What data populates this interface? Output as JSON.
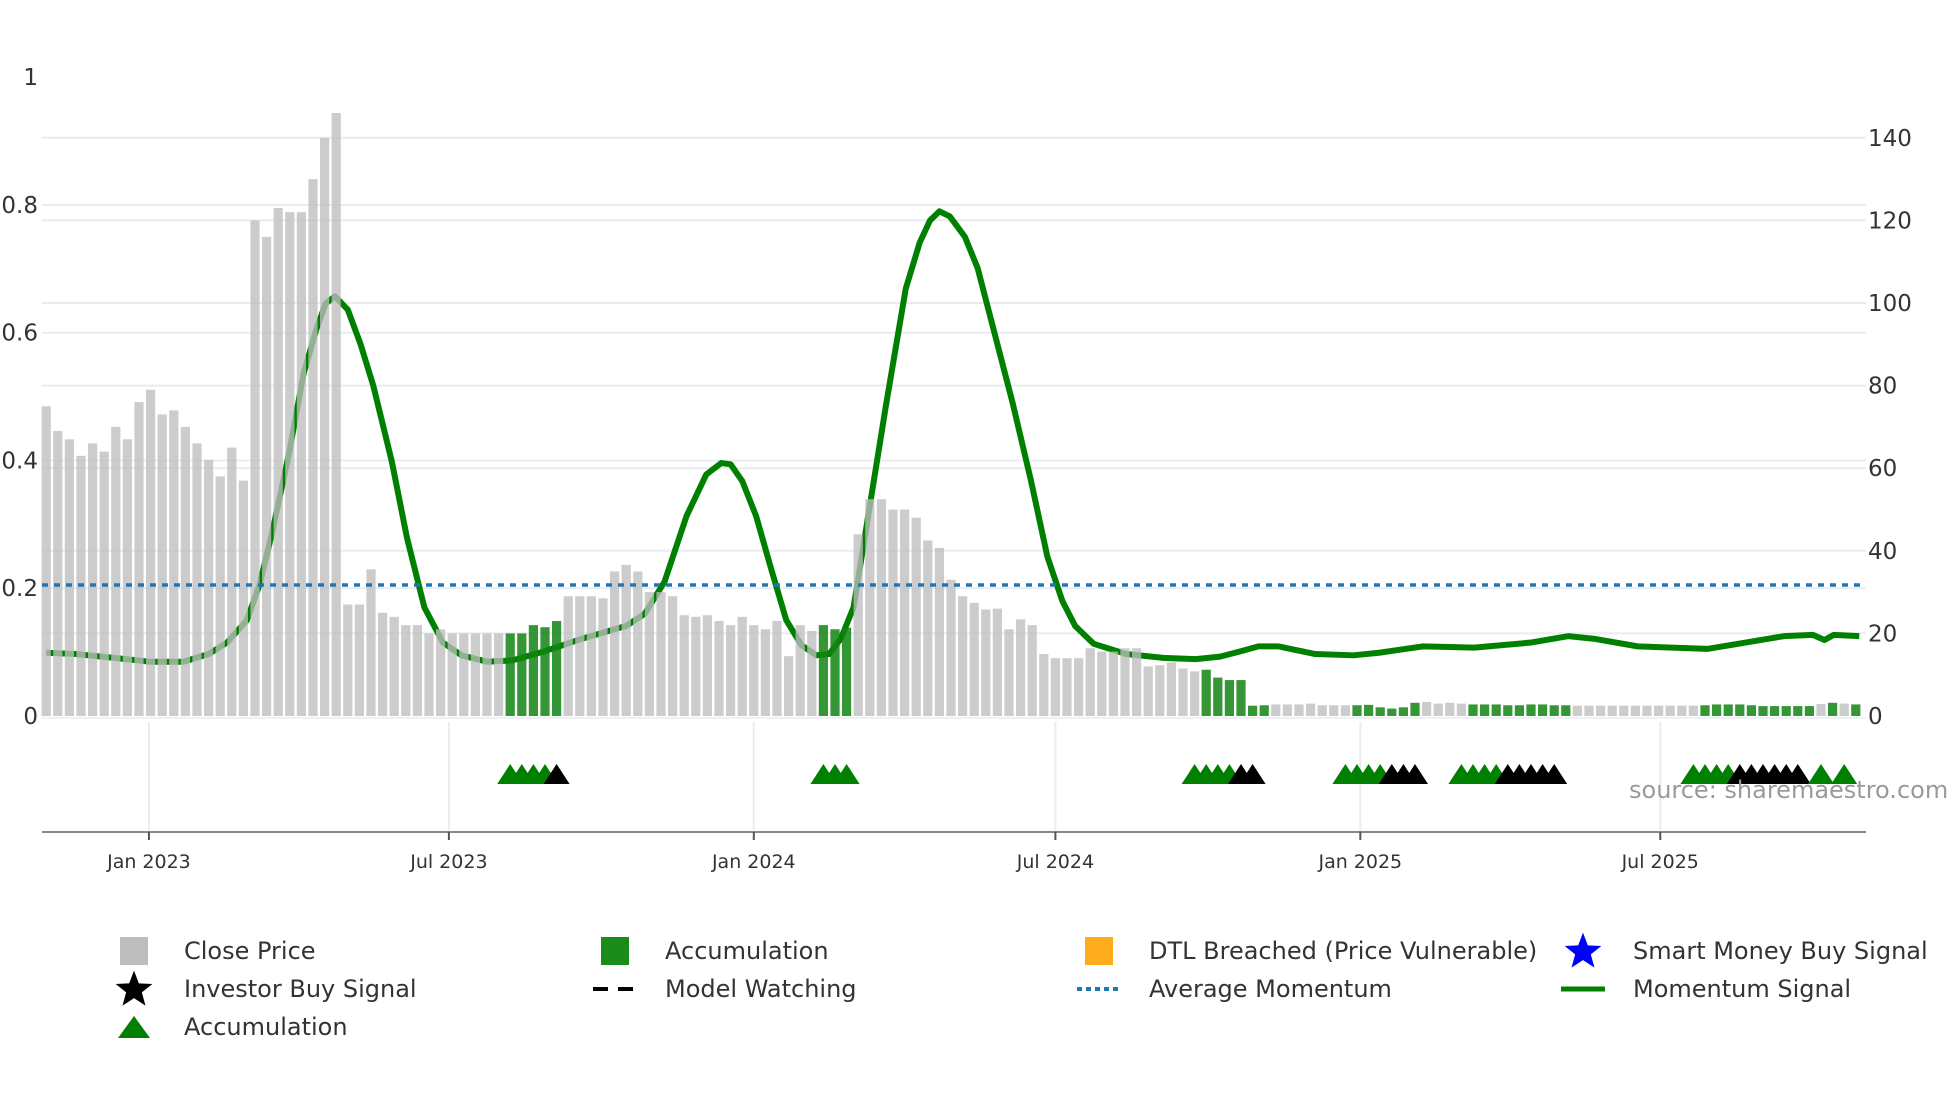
{
  "chart_data": {
    "type": "bar+line",
    "title": "",
    "start_week": "2022-10-31",
    "left_axis": {
      "label": "",
      "ylim": [
        0,
        1
      ],
      "ticks": [
        "0",
        "0.2",
        "0.4",
        "0.6",
        "0.8",
        "1"
      ],
      "tick_values": [
        0,
        0.2,
        0.4,
        0.6,
        0.8,
        1
      ]
    },
    "right_axis": {
      "label": "",
      "ylim": [
        0,
        150
      ],
      "ticks": [
        "0",
        "20",
        "40",
        "60",
        "80",
        "100",
        "120",
        "140"
      ],
      "tick_values": [
        0,
        20,
        40,
        60,
        80,
        100,
        120,
        140
      ]
    },
    "x_ticks": [
      {
        "label": "Jan 2023",
        "date": "2023-01-01"
      },
      {
        "label": "Jul 2023",
        "date": "2023-07-01"
      },
      {
        "label": "Jan 2024",
        "date": "2024-01-01"
      },
      {
        "label": "Jul 2024",
        "date": "2024-07-01"
      },
      {
        "label": "Jan 2025",
        "date": "2025-01-01"
      },
      {
        "label": "Jul 2025",
        "date": "2025-07-01"
      }
    ],
    "close_price": [
      75,
      69,
      67,
      63,
      66,
      64,
      70,
      67,
      76,
      79,
      73,
      74,
      70,
      66,
      62,
      58,
      65,
      57,
      120,
      116,
      123,
      122,
      122,
      130,
      140,
      146,
      27,
      27,
      35.5,
      25,
      24,
      22,
      22,
      20,
      21,
      20,
      20,
      20,
      20,
      20,
      20,
      20,
      22,
      21.5,
      23,
      29,
      29,
      29,
      28.5,
      35,
      36.6,
      35,
      30,
      30,
      29,
      24.4,
      24,
      24.4,
      23,
      22,
      24,
      22,
      21,
      23,
      14.5,
      22,
      20.6,
      22,
      21,
      21.4,
      44,
      52.5,
      52.5,
      50,
      50,
      48,
      42.5,
      40.7,
      33,
      29,
      27.4,
      25.8,
      26,
      21,
      23.4,
      22,
      15,
      14,
      14,
      14,
      16.4,
      15.6,
      15.6,
      16.4,
      16.4,
      12,
      12.3,
      13,
      11.5,
      10.8,
      11.2,
      9.3,
      8.7,
      8.7,
      2.5,
      2.6,
      2.8,
      2.8,
      2.8,
      3,
      2.6,
      2.6,
      2.6,
      2.6,
      2.7,
      2.1,
      1.8,
      2.1,
      3.2,
      3.4,
      3,
      3.2,
      3,
      2.8,
      2.8,
      2.8,
      2.6,
      2.6,
      2.8,
      2.8,
      2.6,
      2.6,
      2.5,
      2.5,
      2.5,
      2.5,
      2.5,
      2.5,
      2.5,
      2.5,
      2.5,
      2.5,
      2.5,
      2.6,
      2.8,
      2.8,
      2.8,
      2.6,
      2.4,
      2.4,
      2.4,
      2.4,
      2.4,
      2.9,
      3.2,
      3,
      2.8
    ],
    "accumulation_weeks": [
      40,
      41,
      42,
      43,
      44,
      67,
      68,
      69,
      100,
      101,
      102,
      103,
      104,
      105,
      113,
      114,
      115,
      116,
      117,
      118,
      123,
      124,
      125,
      126,
      127,
      128,
      129,
      130,
      131,
      143,
      144,
      145,
      146,
      147,
      148,
      149,
      150,
      151,
      152,
      154,
      156
    ],
    "momentum_signal": [
      [
        0,
        0.099
      ],
      [
        2.56,
        0.097
      ],
      [
        5.83,
        0.091
      ],
      [
        8.89,
        0.085
      ],
      [
        11.83,
        0.085
      ],
      [
        14,
        0.097
      ],
      [
        15.6,
        0.115
      ],
      [
        17.3,
        0.15
      ],
      [
        18.4,
        0.206
      ],
      [
        19.5,
        0.289
      ],
      [
        20.9,
        0.408
      ],
      [
        22.2,
        0.537
      ],
      [
        23.3,
        0.606
      ],
      [
        24.1,
        0.646
      ],
      [
        24.9,
        0.657
      ],
      [
        26,
        0.636
      ],
      [
        27.1,
        0.582
      ],
      [
        28.2,
        0.517
      ],
      [
        29.8,
        0.398
      ],
      [
        31.1,
        0.279
      ],
      [
        32.6,
        0.17
      ],
      [
        34.2,
        0.115
      ],
      [
        35.8,
        0.095
      ],
      [
        38,
        0.085
      ],
      [
        40.2,
        0.087
      ],
      [
        42.9,
        0.101
      ],
      [
        46.2,
        0.121
      ],
      [
        50,
        0.141
      ],
      [
        51.6,
        0.16
      ],
      [
        53.3,
        0.21
      ],
      [
        55.2,
        0.313
      ],
      [
        56.9,
        0.378
      ],
      [
        58.2,
        0.396
      ],
      [
        59,
        0.394
      ],
      [
        60,
        0.368
      ],
      [
        61.2,
        0.313
      ],
      [
        62.5,
        0.23
      ],
      [
        63.8,
        0.15
      ],
      [
        65.1,
        0.111
      ],
      [
        66.4,
        0.095
      ],
      [
        67.5,
        0.097
      ],
      [
        68.5,
        0.121
      ],
      [
        69.6,
        0.17
      ],
      [
        71,
        0.329
      ],
      [
        72.4,
        0.487
      ],
      [
        74.1,
        0.669
      ],
      [
        75.3,
        0.741
      ],
      [
        76.2,
        0.776
      ],
      [
        77,
        0.79
      ],
      [
        77.9,
        0.782
      ],
      [
        79.2,
        0.75
      ],
      [
        80.3,
        0.701
      ],
      [
        81.8,
        0.596
      ],
      [
        83.3,
        0.491
      ],
      [
        84.9,
        0.368
      ],
      [
        86.3,
        0.25
      ],
      [
        87.6,
        0.18
      ],
      [
        88.7,
        0.141
      ],
      [
        90.3,
        0.113
      ],
      [
        93.1,
        0.097
      ],
      [
        96.3,
        0.091
      ],
      [
        99.1,
        0.089
      ],
      [
        101.2,
        0.093
      ],
      [
        102.9,
        0.101
      ],
      [
        104.5,
        0.109
      ],
      [
        106.2,
        0.109
      ],
      [
        109.4,
        0.097
      ],
      [
        112.7,
        0.095
      ],
      [
        114.9,
        0.099
      ],
      [
        118.7,
        0.109
      ],
      [
        123.1,
        0.107
      ],
      [
        128,
        0.115
      ],
      [
        131.2,
        0.125
      ],
      [
        133.4,
        0.121
      ],
      [
        137.2,
        0.109
      ],
      [
        143.2,
        0.105
      ],
      [
        146.5,
        0.115
      ],
      [
        149.8,
        0.125
      ],
      [
        152.3,
        0.127
      ],
      [
        153.3,
        0.119
      ],
      [
        154.1,
        0.127
      ],
      [
        156.3,
        0.125
      ]
    ],
    "average_momentum": 0.205,
    "signal_markers": [
      {
        "week": 40,
        "type": "accumulation"
      },
      {
        "week": 41,
        "type": "accumulation"
      },
      {
        "week": 42,
        "type": "accumulation"
      },
      {
        "week": 43,
        "type": "accumulation"
      },
      {
        "week": 44,
        "type": "investor_buy"
      },
      {
        "week": 67,
        "type": "accumulation"
      },
      {
        "week": 68,
        "type": "accumulation"
      },
      {
        "week": 69,
        "type": "accumulation"
      },
      {
        "week": 99,
        "type": "accumulation"
      },
      {
        "week": 100,
        "type": "accumulation"
      },
      {
        "week": 101,
        "type": "accumulation"
      },
      {
        "week": 102,
        "type": "accumulation"
      },
      {
        "week": 103,
        "type": "investor_buy"
      },
      {
        "week": 104,
        "type": "investor_buy"
      },
      {
        "week": 112,
        "type": "accumulation"
      },
      {
        "week": 113,
        "type": "accumulation"
      },
      {
        "week": 114,
        "type": "accumulation"
      },
      {
        "week": 115,
        "type": "accumulation"
      },
      {
        "week": 116,
        "type": "investor_buy"
      },
      {
        "week": 117,
        "type": "investor_buy"
      },
      {
        "week": 118,
        "type": "investor_buy"
      },
      {
        "week": 122,
        "type": "accumulation"
      },
      {
        "week": 123,
        "type": "accumulation"
      },
      {
        "week": 124,
        "type": "accumulation"
      },
      {
        "week": 125,
        "type": "accumulation"
      },
      {
        "week": 126,
        "type": "investor_buy"
      },
      {
        "week": 127,
        "type": "investor_buy"
      },
      {
        "week": 128,
        "type": "investor_buy"
      },
      {
        "week": 129,
        "type": "investor_buy"
      },
      {
        "week": 130,
        "type": "investor_buy"
      },
      {
        "week": 142,
        "type": "accumulation"
      },
      {
        "week": 143,
        "type": "accumulation"
      },
      {
        "week": 144,
        "type": "accumulation"
      },
      {
        "week": 145,
        "type": "accumulation"
      },
      {
        "week": 146,
        "type": "investor_buy"
      },
      {
        "week": 147,
        "type": "investor_buy"
      },
      {
        "week": 148,
        "type": "investor_buy"
      },
      {
        "week": 149,
        "type": "investor_buy"
      },
      {
        "week": 150,
        "type": "investor_buy"
      },
      {
        "week": 151,
        "type": "investor_buy"
      },
      {
        "week": 153,
        "type": "accumulation"
      },
      {
        "week": 155,
        "type": "accumulation"
      }
    ],
    "colors": {
      "close": "#bdbdbd",
      "accumulation": "#1a8c1a",
      "momentum": "#008000",
      "average": "#1f77b4",
      "investor": "#000000",
      "smart_money": "#0000ff",
      "dtl": "#ffa500"
    },
    "legend": [
      {
        "label": "Close Price",
        "symbol": "gray-square"
      },
      {
        "label": "Accumulation",
        "symbol": "green-square"
      },
      {
        "label": "DTL Breached (Price Vulnerable)",
        "symbol": "orange-square"
      },
      {
        "label": "Smart Money Buy Signal",
        "symbol": "blue-star"
      },
      {
        "label": "Investor Buy Signal",
        "symbol": "black-star"
      },
      {
        "label": "Model Watching",
        "symbol": "black-dashed-line"
      },
      {
        "label": "Average Momentum",
        "symbol": "blue-dotted-line"
      },
      {
        "label": "Momentum Signal",
        "symbol": "green-line"
      },
      {
        "label": "Accumulation",
        "symbol": "green-triangle"
      }
    ],
    "legend_placement": "bottom",
    "source": "source: sharemaestro.com"
  }
}
